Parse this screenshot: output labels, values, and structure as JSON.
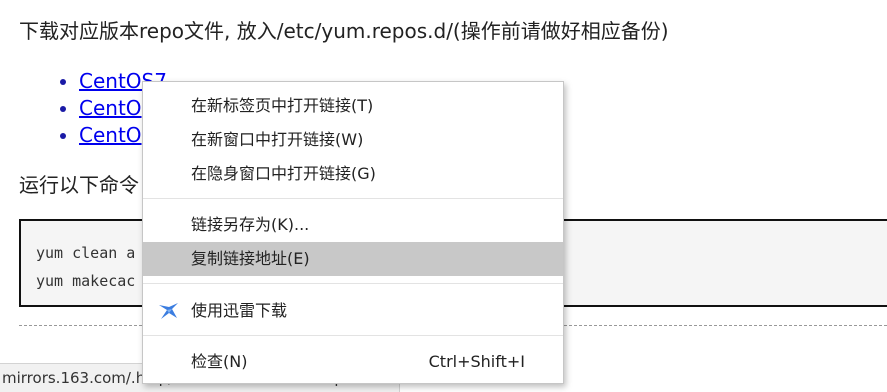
{
  "page": {
    "instruction": "下载对应版本repo文件, 放入/etc/yum.repos.d/(操作前请做好相应备份)",
    "links": [
      {
        "label": "CentOS7"
      },
      {
        "label": "CentO"
      },
      {
        "label": "CentO"
      }
    ],
    "run_text": "运行以下命令",
    "code_lines": [
      "yum clean a",
      "yum makecac"
    ]
  },
  "status_bar": {
    "url": "mirrors.163.com/.help/CentOS7-Base-163.repo"
  },
  "context_menu": {
    "items": [
      {
        "label": "在新标签页中打开链接(T)"
      },
      {
        "label": "在新窗口中打开链接(W)"
      },
      {
        "label": "在隐身窗口中打开链接(G)"
      },
      {
        "label": "链接另存为(K)..."
      },
      {
        "label": "复制链接地址(E)"
      },
      {
        "label": "使用迅雷下载",
        "icon": "thunder-icon"
      },
      {
        "label": "检查(N)",
        "shortcut": "Ctrl+Shift+I"
      }
    ]
  },
  "colors": {
    "link": "#0000ee",
    "highlight": "#c8c8c8",
    "thunder_blue": "#3b7de0"
  }
}
